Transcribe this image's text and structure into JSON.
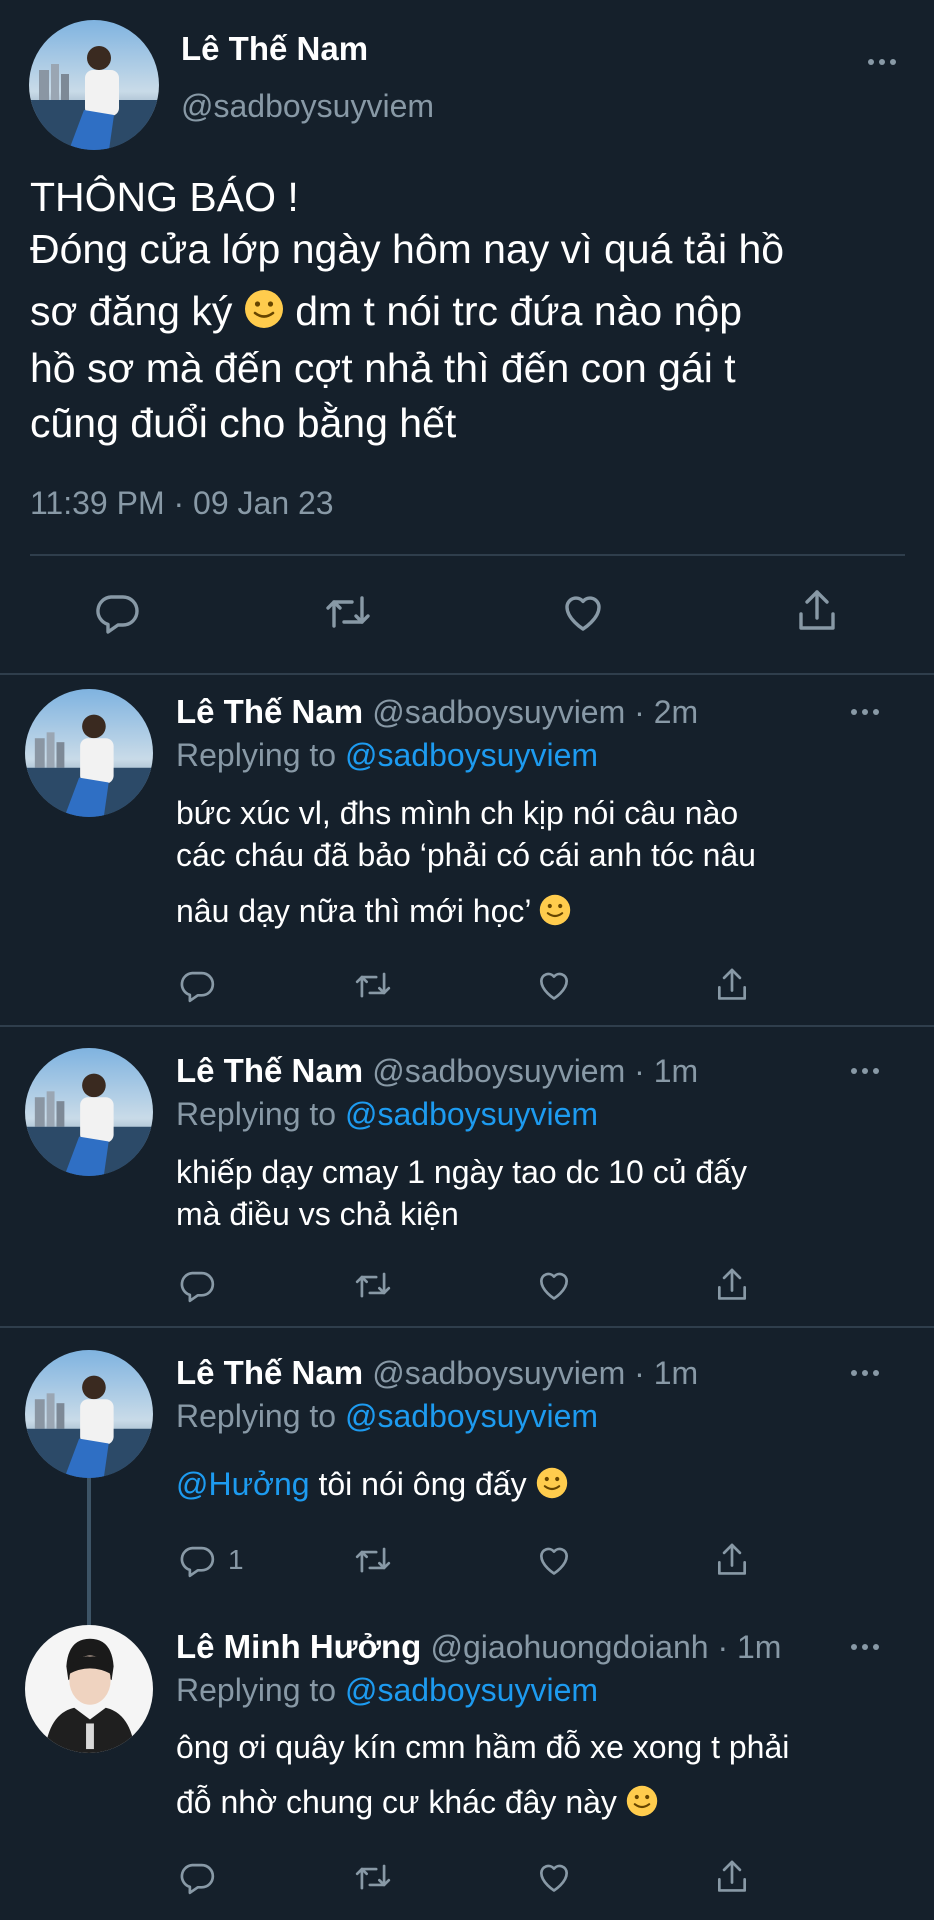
{
  "main_tweet": {
    "name": "Lê Thế Nam",
    "handle": "@sadboysuyviem",
    "text_line1": "THÔNG BÁO !",
    "text_line2": "Đóng cửa lớp ngày hôm nay vì quá tải hồ",
    "text_line3a": "sơ đăng ký",
    "text_line3b": "dm t nói trc đứa nào nộp",
    "text_line4": "hồ sơ mà đến cợt nhả thì đến con gái t",
    "text_line5": "cũng đuổi cho bằng hết",
    "timestamp": "11:39 PM · 09 Jan 23"
  },
  "replies": [
    {
      "name": "Lê Thế Nam",
      "meta": "@sadboysuyviem · 2m",
      "replying_prefix": "Replying to ",
      "replying_handle": "@sadboysuyviem",
      "line1": "bức xúc vl, đhs mình ch kịp nói câu nào",
      "line2": "các cháu đã bảo ‘phải có cái anh tóc nâu",
      "line3": "nâu dạy nữa thì mới học’"
    },
    {
      "name": "Lê Thế Nam",
      "meta": "@sadboysuyviem · 1m",
      "replying_prefix": "Replying to ",
      "replying_handle": "@sadboysuyviem",
      "line1": "khiếp dạy cmay 1 ngày tao dc 10 củ đấy",
      "line2": "mà điều vs chả kiện"
    },
    {
      "name": "Lê Thế Nam",
      "meta": "@sadboysuyviem · 1m",
      "replying_prefix": "Replying to ",
      "replying_handle": "@sadboysuyviem",
      "mention": "@Hưởng",
      "line1": " tôi nói ông đấy",
      "reply_count": "1"
    },
    {
      "name": "Lê Minh Hưởng",
      "meta": "@giaohuongdoianh · 1m",
      "replying_prefix": "Replying to ",
      "replying_handle": "@sadboysuyviem",
      "line1": "ông ơi quây kín cmn hầm đỗ xe xong t phải",
      "line2": "đỗ nhờ chung cư khác đây này"
    }
  ],
  "icons": {
    "reply": "reply-icon",
    "retweet": "retweet-icon",
    "like": "like-icon",
    "share": "share-icon",
    "more": "more-options-icon",
    "emoji": "slightly-smiling-face-emoji"
  },
  "colors": {
    "background": "#15202b",
    "muted": "#8899a6",
    "link": "#1d9bf0",
    "divider": "#2f3e4c"
  }
}
